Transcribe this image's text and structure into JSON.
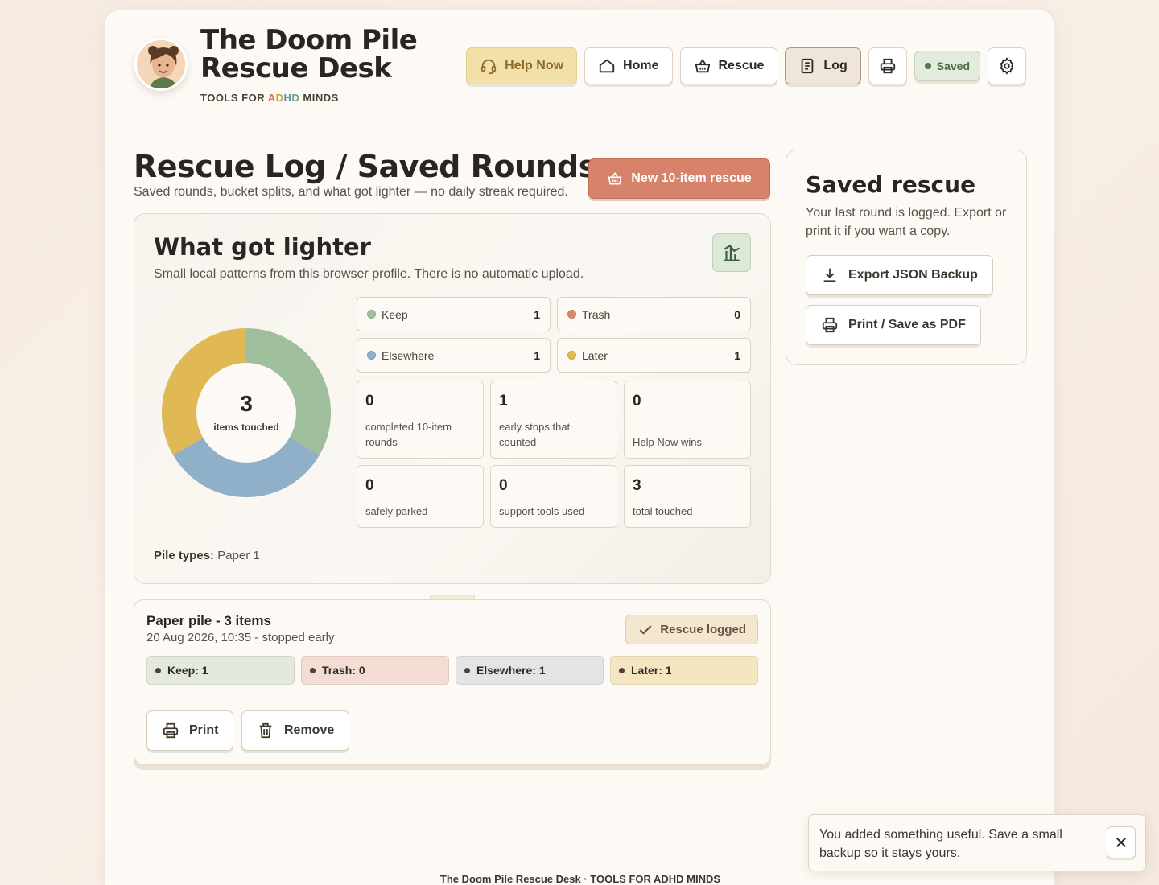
{
  "brand": {
    "title_line1": "The Doom Pile",
    "title_line2": "Rescue Desk",
    "subtitle_pre": "TOOLS FOR ",
    "subtitle_a": "A",
    "subtitle_d": "D",
    "subtitle_h": "H",
    "subtitle_d2": "D",
    "subtitle_post": " MINDS"
  },
  "nav": {
    "help_now": "Help Now",
    "home": "Home",
    "rescue": "Rescue",
    "log": "Log",
    "saved": "Saved",
    "icons": [
      "headset-icon",
      "home-icon",
      "basket-icon",
      "document-icon",
      "printer-icon",
      "gear-icon"
    ]
  },
  "page": {
    "title": "Rescue Log / Saved Rounds",
    "subtitle": "Saved rounds, bucket splits, and what got lighter — no daily streak required.",
    "new_rescue": "New 10-item rescue"
  },
  "stats": {
    "title": "What got lighter",
    "subtitle": "Small local patterns from this browser profile. There is no automatic upload.",
    "donut_total": "3",
    "donut_label": "items touched",
    "buckets": [
      {
        "label": "Keep",
        "value": "1",
        "color": "#9fbf9c"
      },
      {
        "label": "Trash",
        "value": "0",
        "color": "#d68a6a"
      },
      {
        "label": "Elsewhere",
        "value": "1",
        "color": "#8fb0c8"
      },
      {
        "label": "Later",
        "value": "1",
        "color": "#e0b955"
      }
    ],
    "tiles": [
      {
        "num": "0",
        "label": "completed 10-item rounds"
      },
      {
        "num": "1",
        "label": "early stops that counted"
      },
      {
        "num": "0",
        "label": "Help Now wins"
      },
      {
        "num": "0",
        "label": "safely parked"
      },
      {
        "num": "0",
        "label": "support tools used"
      },
      {
        "num": "3",
        "label": "total touched"
      }
    ],
    "pile_types_label": "Pile types:",
    "pile_types_value": "Paper 1"
  },
  "chart_data": {
    "type": "pie",
    "categories": [
      "Keep",
      "Elsewhere",
      "Later",
      "Trash"
    ],
    "values": [
      1,
      1,
      1,
      0
    ],
    "colors": [
      "#9fbf9c",
      "#8fb0c8",
      "#e0b955",
      "#d68a6a"
    ],
    "title": "",
    "center_value": "3",
    "center_label": "items touched"
  },
  "saved": {
    "title": "Saved rescue",
    "text": "Your last round is logged. Export or print it if you want a copy.",
    "export": "Export JSON Backup",
    "print": "Print / Save as PDF"
  },
  "log_entry": {
    "title": "Paper pile - 3 items",
    "meta": "20 Aug 2026, 10:35 - stopped early",
    "badge": "Rescue logged",
    "chips": [
      {
        "label": "Keep: 1",
        "bg": "#e3e9dc"
      },
      {
        "label": "Trash: 0",
        "bg": "#f3dcd2"
      },
      {
        "label": "Elsewhere: 1",
        "bg": "#e2e5e3"
      },
      {
        "label": "Later: 1",
        "bg": "#f5e6c2"
      }
    ],
    "print": "Print",
    "remove": "Remove"
  },
  "footer": {
    "text": "The Doom Pile Rescue Desk · TOOLS FOR ADHD MINDS"
  },
  "toast": {
    "message": "You added something useful. Save a small backup so it stays yours."
  }
}
